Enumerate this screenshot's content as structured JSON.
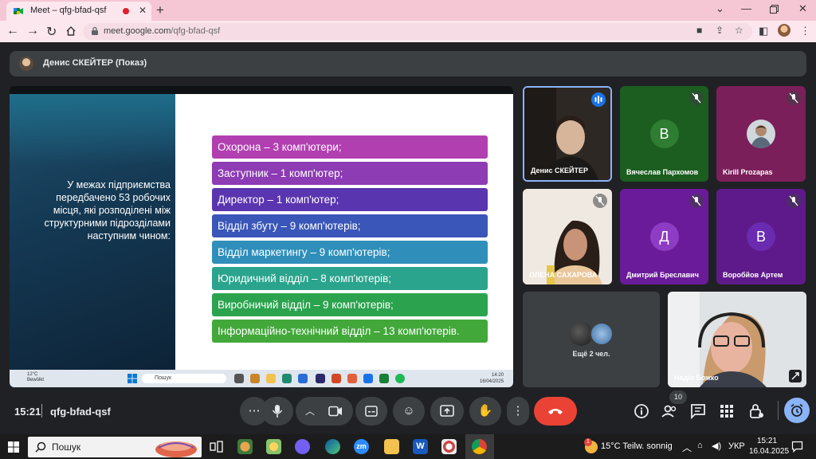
{
  "browser": {
    "tab_title": "Meet – qfg-bfad-qsf",
    "url_host": "meet.google.com",
    "url_path": "/qfg-bfad-qsf",
    "new_tab": "+",
    "close": "✕"
  },
  "meet": {
    "presenter_label": "Денис СКЕЙТЕР (Показ)",
    "slide": {
      "left_text": "У межах підприємства передбачено 53 робочих місця, які розподілені між структурними підрозділами наступним чином:",
      "items": [
        {
          "text": "Охорона – 3 комп'ютери;",
          "color": "#b13fb0"
        },
        {
          "text": "Заступник – 1 комп'ютер;",
          "color": "#8d3cb4"
        },
        {
          "text": "Директор – 1 комп'ютер;",
          "color": "#5a35b0"
        },
        {
          "text": "Відділ збуту – 9 комп'ютерів;",
          "color": "#3956b8"
        },
        {
          "text": "Відділ маркетингу – 9 комп'ютерів;",
          "color": "#2f8fba"
        },
        {
          "text": "Юридичний відділ – 8 комп'ютерів;",
          "color": "#2aa48c"
        },
        {
          "text": "Виробничий відділ – 9 комп'ютерів;",
          "color": "#2ba34e"
        },
        {
          "text": "Інформаційно-технічний відділ – 13 комп'ютерів.",
          "color": "#42a83a"
        }
      ],
      "taskbar_weather_temp": "12°C",
      "taskbar_weather_desc": "Bewölkt",
      "taskbar_search": "Пошук",
      "taskbar_time": "14:20",
      "taskbar_date": "16/04/2025"
    },
    "participants": [
      {
        "name": "Денис СКЕЙТЕР",
        "type": "video"
      },
      {
        "name": "Вячеслав Пархомов",
        "initial": "В",
        "bg": "#1e7e34",
        "avatar_color": "#2e7d32"
      },
      {
        "name": "Kirill Prozapas",
        "type": "photo",
        "bg": "#7b1f5a"
      },
      {
        "name": "ОЛЕНА САХАРОВА",
        "type": "video"
      },
      {
        "name": "Дмитрий Бреславич",
        "initial": "Д",
        "bg": "#6a1b9a",
        "avatar_color": "#8e3cc4"
      },
      {
        "name": "Воробйов Артем",
        "initial": "В",
        "bg": "#5e1a8a",
        "avatar_color": "#6a2bb0"
      },
      {
        "name": "Надія Божко",
        "type": "video"
      }
    ],
    "more_participants": "Ещё 2 чел.",
    "time": "15:21",
    "meeting_code": "qfg-bfad-qsf",
    "participant_count": "10"
  },
  "taskbar": {
    "search_label": "Пошук",
    "weather": "15°C  Teilw. sonnig",
    "notification_count": "1",
    "language": "УКР",
    "time": "15:21",
    "date": "16.04.2025"
  }
}
